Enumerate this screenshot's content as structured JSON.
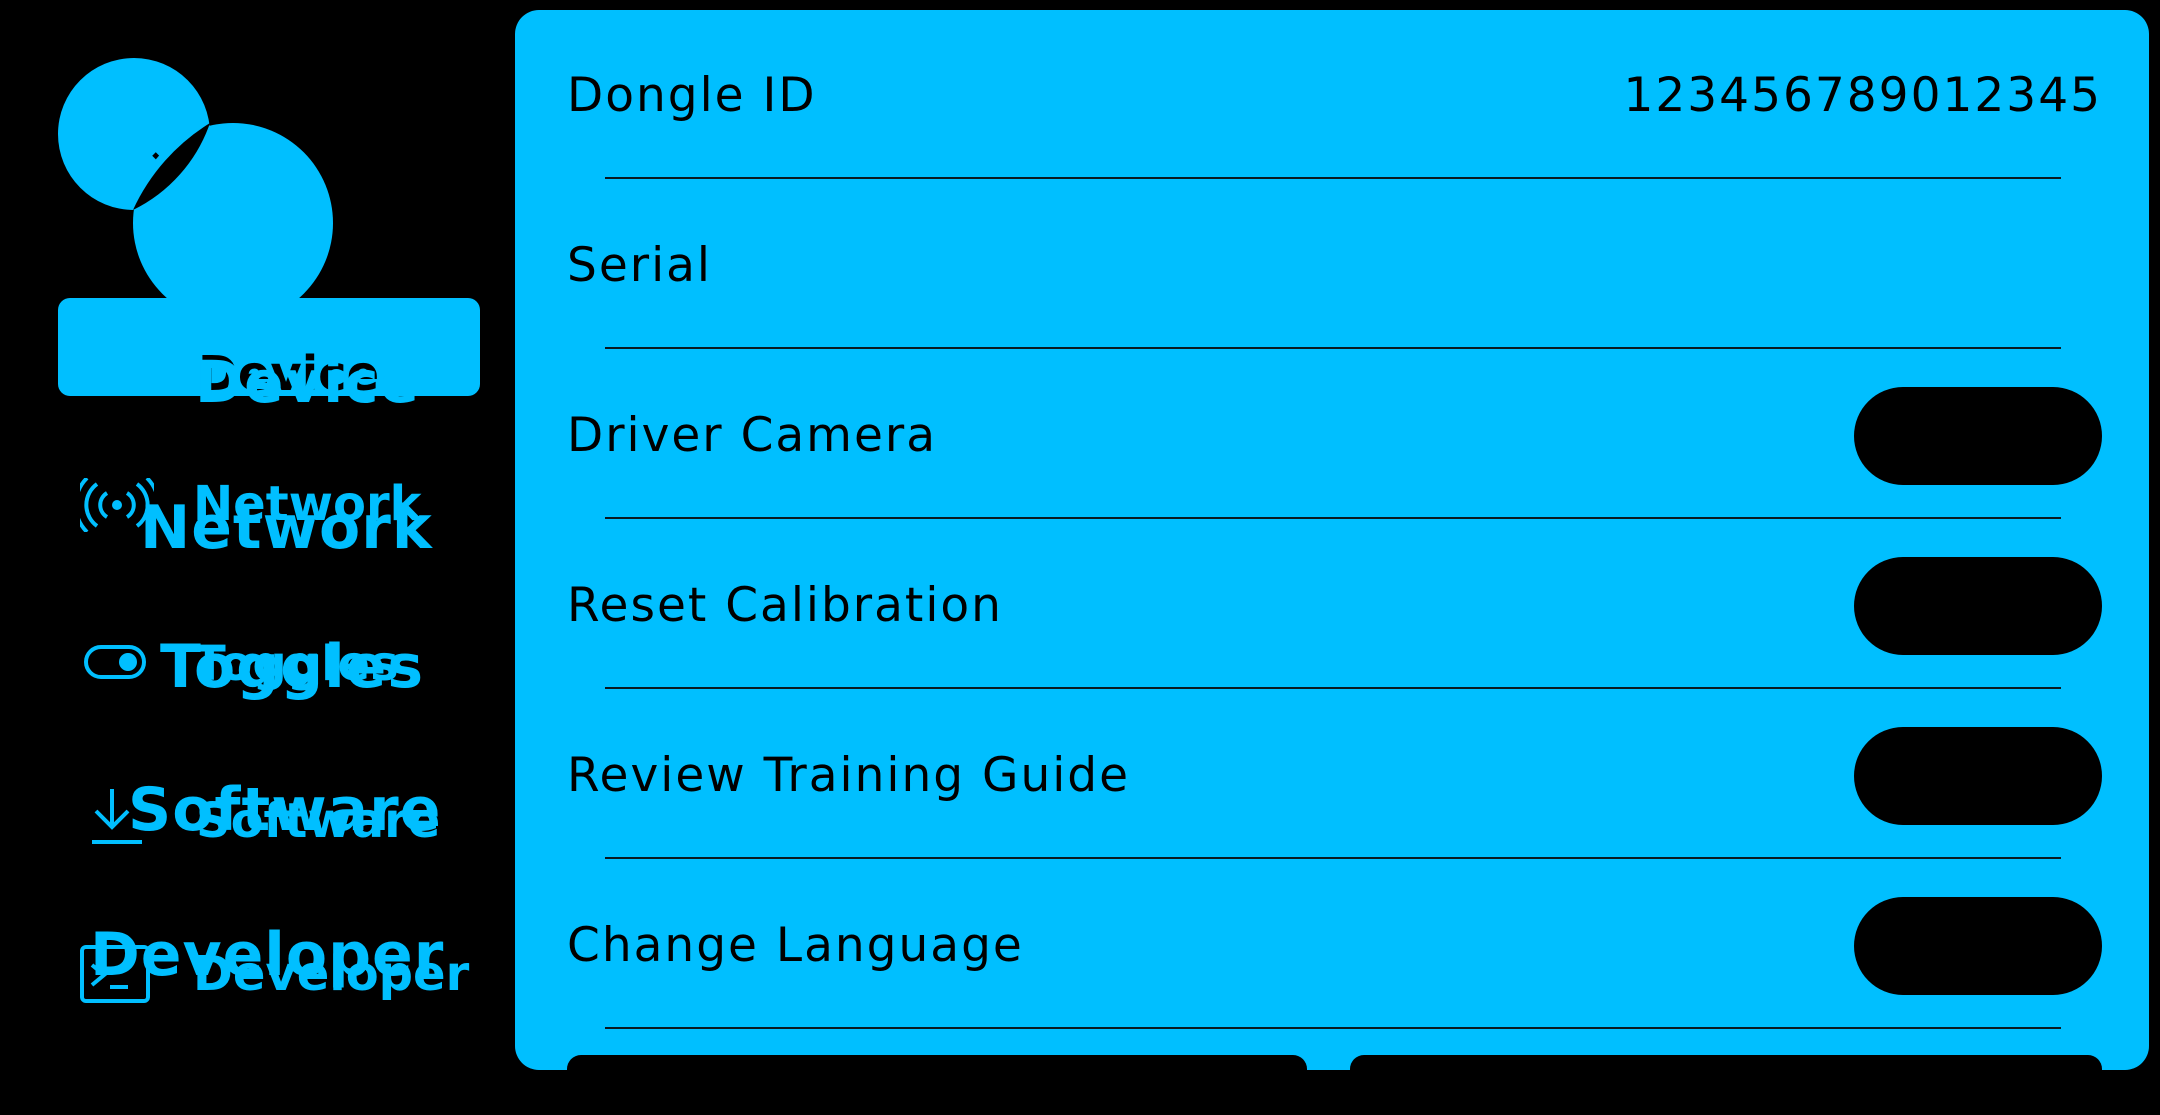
{
  "colors": {
    "accent": "#00bfff",
    "background": "#000000"
  },
  "sidebar": {
    "close_icon": "close-icon",
    "settings_icon": "settings-icon",
    "items": [
      {
        "label": "Device",
        "icon": "",
        "active": true
      },
      {
        "label": "Network",
        "icon": "wifi-icon",
        "active": false
      },
      {
        "label": "Toggles",
        "icon": "toggle-icon",
        "active": false
      },
      {
        "label": "Software",
        "icon": "download-icon",
        "active": false
      },
      {
        "label": "Developer",
        "icon": "terminal-icon",
        "active": false
      }
    ]
  },
  "device": {
    "rows": [
      {
        "label": "Dongle ID",
        "value": "123456789012345"
      },
      {
        "label": "Serial",
        "value": ""
      },
      {
        "label": "Driver Camera",
        "button_label": ""
      },
      {
        "label": "Reset Calibration",
        "button_label": ""
      },
      {
        "label": "Review Training Guide",
        "button_label": ""
      },
      {
        "label": "Change Language",
        "button_label": ""
      }
    ]
  }
}
